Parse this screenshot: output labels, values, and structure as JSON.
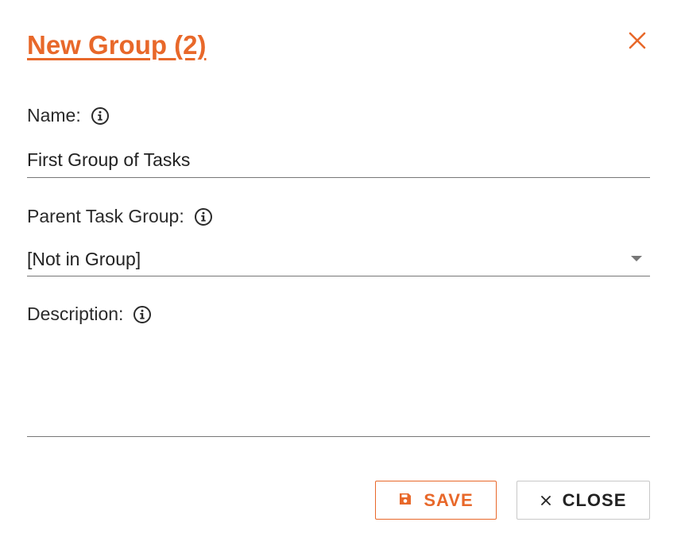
{
  "dialog": {
    "title": "New Group (2)",
    "accent_color": "#e8682a"
  },
  "fields": {
    "name": {
      "label": "Name:",
      "value": "First Group of Tasks"
    },
    "parent_group": {
      "label": "Parent Task Group:",
      "selected": "[Not in Group]"
    },
    "description": {
      "label": "Description:",
      "value": ""
    }
  },
  "buttons": {
    "save_label": "SAVE",
    "close_label": "CLOSE"
  },
  "icons": {
    "close": "close-icon",
    "info": "info-icon",
    "save": "floppy-disk-icon",
    "dropdown": "caret-down-icon"
  }
}
